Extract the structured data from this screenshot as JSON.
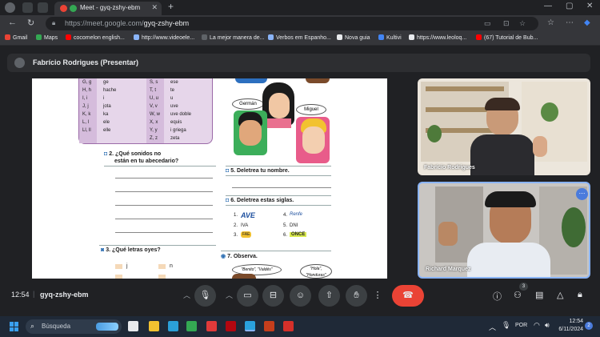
{
  "browser": {
    "tab_title": "Meet - gyq-zshy-ebm",
    "url_host": "https://meet.google.com/",
    "url_path": "gyq-zshy-ebm",
    "bookmarks": [
      {
        "label": "Gmail",
        "color": "#ea4335"
      },
      {
        "label": "Maps",
        "color": "#34a853"
      },
      {
        "label": "cocomelon english...",
        "color": "#ff0000"
      },
      {
        "label": "http://www.videoele...",
        "color": "#8ab4f8"
      },
      {
        "label": "La mejor manera de...",
        "color": "#5f6368"
      },
      {
        "label": "Verbos em Espanho...",
        "color": "#8ab4f8"
      },
      {
        "label": "Nova guia",
        "color": "#e8eaed"
      },
      {
        "label": "Kultivi",
        "color": "#4285f4"
      },
      {
        "label": "https://www.leoloq...",
        "color": "#e8eaed"
      },
      {
        "label": "(67) Tutorial de Bub...",
        "color": "#ff0000"
      }
    ]
  },
  "meet": {
    "presenter_label": "Fabrício Rodrigues (Presentar)",
    "participants": [
      {
        "name": "Fabrício Rodrigues"
      },
      {
        "name": "Richard Marquez"
      }
    ],
    "time": "12:54",
    "meeting_code": "gyq-zshy-ebm",
    "participant_count": "3",
    "accent_end_call": "#ea4335"
  },
  "document": {
    "alphabet_rows": [
      [
        "G, g",
        "ge",
        "S, s",
        "ese"
      ],
      [
        "H, h",
        "hache",
        "T, t",
        "te"
      ],
      [
        "I, i",
        "i",
        "U, u",
        "u"
      ],
      [
        "J, j",
        "jota",
        "V, v",
        "uve"
      ],
      [
        "K, k",
        "ka",
        "W, w",
        "uve doble"
      ],
      [
        "L, l",
        "ele",
        "X, x",
        "equis"
      ],
      [
        "Ll, ll",
        "elle",
        "Y, y",
        "i griega"
      ],
      [
        "",
        "",
        "Z, z",
        "zeta"
      ]
    ],
    "q2": "2. ¿Qué sonidos no",
    "q2b": "están en tu abecedario?",
    "q3": "3. ¿Qué letras oyes?",
    "q3_options": [
      "j",
      "n"
    ],
    "q5": "5. Deletrea tu nombre.",
    "q6": "6. Deletrea estas siglas.",
    "siglas": [
      "1.",
      "AVE",
      "4.",
      "Renfe",
      "2.",
      "IVA",
      "5.",
      "DNI",
      "3.",
      "FAE",
      "6.",
      "ONCE"
    ],
    "q7": "7. Observa.",
    "bubbles": [
      "Germán",
      "Miguel",
      "\"Benito\", \"Valdés\"",
      "\"Hola\", \"Honduras\""
    ]
  },
  "taskbar": {
    "search_placeholder": "Búsqueda",
    "lang": "POR",
    "clock_time": "12:54",
    "clock_date": "6/11/2024",
    "notif_count": "2"
  }
}
